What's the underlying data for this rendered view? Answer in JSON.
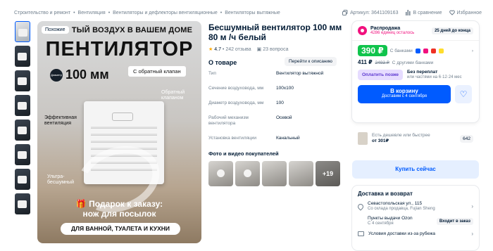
{
  "breadcrumbs": [
    "Строительство и ремонт",
    "Вентиляция",
    "Вентиляторы и дефлекторы вентиляционные",
    "Вентиляторы вытяжные"
  ],
  "breadcrumb_sep": "•",
  "top_actions": {
    "article": "Артикул: 3641109163",
    "compare": "В сравнение",
    "favorite": "Избранное"
  },
  "gallery": {
    "badge": "Похожие",
    "headline1": "ТЫЙ ВОЗДУХ В ВАШЕМ ДОМЕ",
    "headline2": "ПЕНТИЛЯТОР",
    "diameter_label": "Диаметр",
    "diameter_value": "100 мм",
    "valve": "С обратный клапан",
    "label_valve": "Обратный\nклапаном",
    "label_efficient": "Эффективная\nвентиляция",
    "label_silent": "Ультра-\nбесшумный",
    "gift": "🎁 Подарок к заказу:\nнож для посылок",
    "pill": "ДЛЯ ВАННОЙ, ТУАЛЕТА И КУХНИ"
  },
  "product": {
    "title": "Бесшумный вентилятор 100 мм 80 м /ч белый",
    "rating": "4.7",
    "reviews": "242 отзыва",
    "questions": "23 вопроса",
    "about_title": "О товаре",
    "go_description": "Перейти к описанию",
    "specs": [
      {
        "k": "Тип",
        "v": "Вентилятор вытяжной"
      },
      {
        "k": "Сечение воздуховода, мм",
        "v": "100x100"
      },
      {
        "k": "Диаметр воздуховода, мм",
        "v": "100"
      },
      {
        "k": "Рабочий механизм вентилятора",
        "v": "Осевой"
      },
      {
        "k": "Установка вентиляции",
        "v": "Канальный"
      }
    ],
    "photos_title": "Фото и видео покупателей",
    "photos_more": "+19"
  },
  "buy": {
    "sale_title": "Распродажа",
    "sale_sub": "4286 единиц осталось",
    "sale_ends": "25 дней до конца",
    "price_bank": "390 ₽",
    "bank_label": "С банками",
    "price_other": "411 ₽",
    "price_old": "2493 ₽",
    "other_label": "С другими банками",
    "split_button": "Оплатить позже",
    "split_title": "Без переплат",
    "split_sub": "или частями на 6·12·24 мес",
    "cart_label": "В корзину",
    "cart_sub": "Доставим с 4 сентября",
    "cheaper_text": "Есть дешевле или быстрее",
    "cheaper_price": "от 301₽",
    "cheaper_count": "642",
    "buy_now": "Купить сейчас"
  },
  "delivery": {
    "title": "Доставка и возврат",
    "address": "Севастопольская ул., 115",
    "address_sub": "Со склада продавца, Fujian Sheng",
    "pickup": "Пункты выдачи Ozon",
    "pickup_sub": "С 4 сентября",
    "pickup_btn": "Входит в заказ",
    "returns": "Условия доставки из-за рубежа"
  },
  "colors": {
    "accent": "#005bff",
    "sale": "#f1117e",
    "price": "#10c44c"
  }
}
